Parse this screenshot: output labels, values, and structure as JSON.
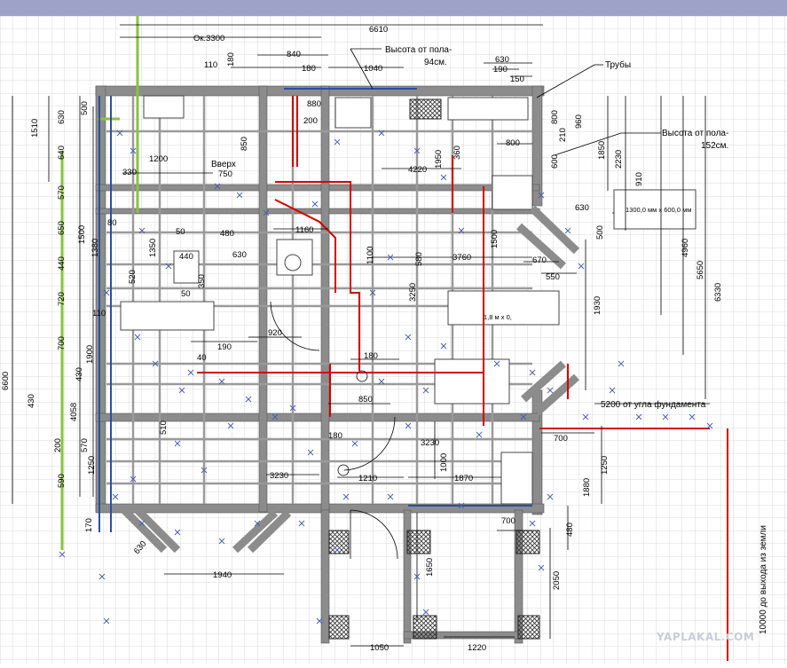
{
  "window": {
    "titlebar_color": "#9ea2c9"
  },
  "colors": {
    "grid": "#d4d4d4",
    "wall": "#8c8c8c",
    "red_pipe": "#d40000",
    "green_line": "#86c43d",
    "blue_line": "#2b4fa3",
    "dim_line": "#000000"
  },
  "annotations": {
    "height_94": "Высота от пола-",
    "height_94b": "94см.",
    "height_152": "Высота от пола-",
    "height_152b": "152см.",
    "pipes": "Трубы",
    "stairs_up": "Вверх",
    "box_size": "1300,0 мм х 600,0 мм",
    "table_size": "1,8 м х 0,",
    "foundation": "5200 от угла фундамента",
    "ground_exit": "10000 до выхода из земли"
  },
  "dimensions": {
    "d6610": "6610",
    "d3300": "Ок.3300",
    "d840": "840",
    "d180a": "180",
    "d110": "110",
    "d180b": "180",
    "d1040": "1040",
    "d630a": "630",
    "d190": "190",
    "d150": "150",
    "d880": "880",
    "d200": "200",
    "d800a": "800",
    "d800b": "800",
    "d210": "210",
    "d960": "960",
    "d600a": "600",
    "d1850": "1850",
    "d2230": "2230",
    "d1510": "1510",
    "d630b": "630",
    "d500a": "500",
    "d640": "640",
    "d570a": "570",
    "d850a": "850",
    "d1200": "1200",
    "d330": "330",
    "d750": "750",
    "d1950": "1950",
    "d4220": "4220",
    "d910": "910",
    "d630c": "630",
    "d500b": "500",
    "d4960": "4960",
    "d5650": "5650",
    "d6330": "6330",
    "d1160": "1160",
    "d480": "480",
    "d50": "50",
    "d440": "440",
    "d630d": "630",
    "d1500": "1500",
    "d650": "650",
    "d80": "80",
    "d1380": "1380",
    "d1350": "1350",
    "d3760": "3760",
    "d670": "670",
    "d550": "550",
    "d1930": "1930",
    "d3250": "3250",
    "d580": "580",
    "d440b": "440",
    "d720": "720",
    "d110b": "110",
    "d700a": "700",
    "d1900": "1900",
    "d190b": "190",
    "d920": "920",
    "d40": "40",
    "d180c": "180",
    "d430a": "430",
    "d430b": "430",
    "d6600": "6600",
    "d4058": "4058",
    "d850b": "850",
    "d700b": "700",
    "d3230a": "3230",
    "d200b": "200",
    "d570b": "570",
    "d1250a": "1250",
    "d590": "590",
    "d3230b": "3230",
    "d1210": "1210",
    "d1870": "1870",
    "d1250b": "1250",
    "d1880": "1880",
    "d170": "170",
    "d700c": "700",
    "d480b": "480",
    "d630e": "630",
    "d1940": "1940",
    "d1650": "1650",
    "d2050": "2050",
    "d1050": "1050",
    "d1220": "1220",
    "d510": "510",
    "d50b": "50",
    "d520": "520",
    "d350": "350",
    "d1100": "1100",
    "d1000": "1000",
    "d360": "360",
    "d1500b": "1500"
  },
  "watermark": "YAPLAKAL.COM"
}
